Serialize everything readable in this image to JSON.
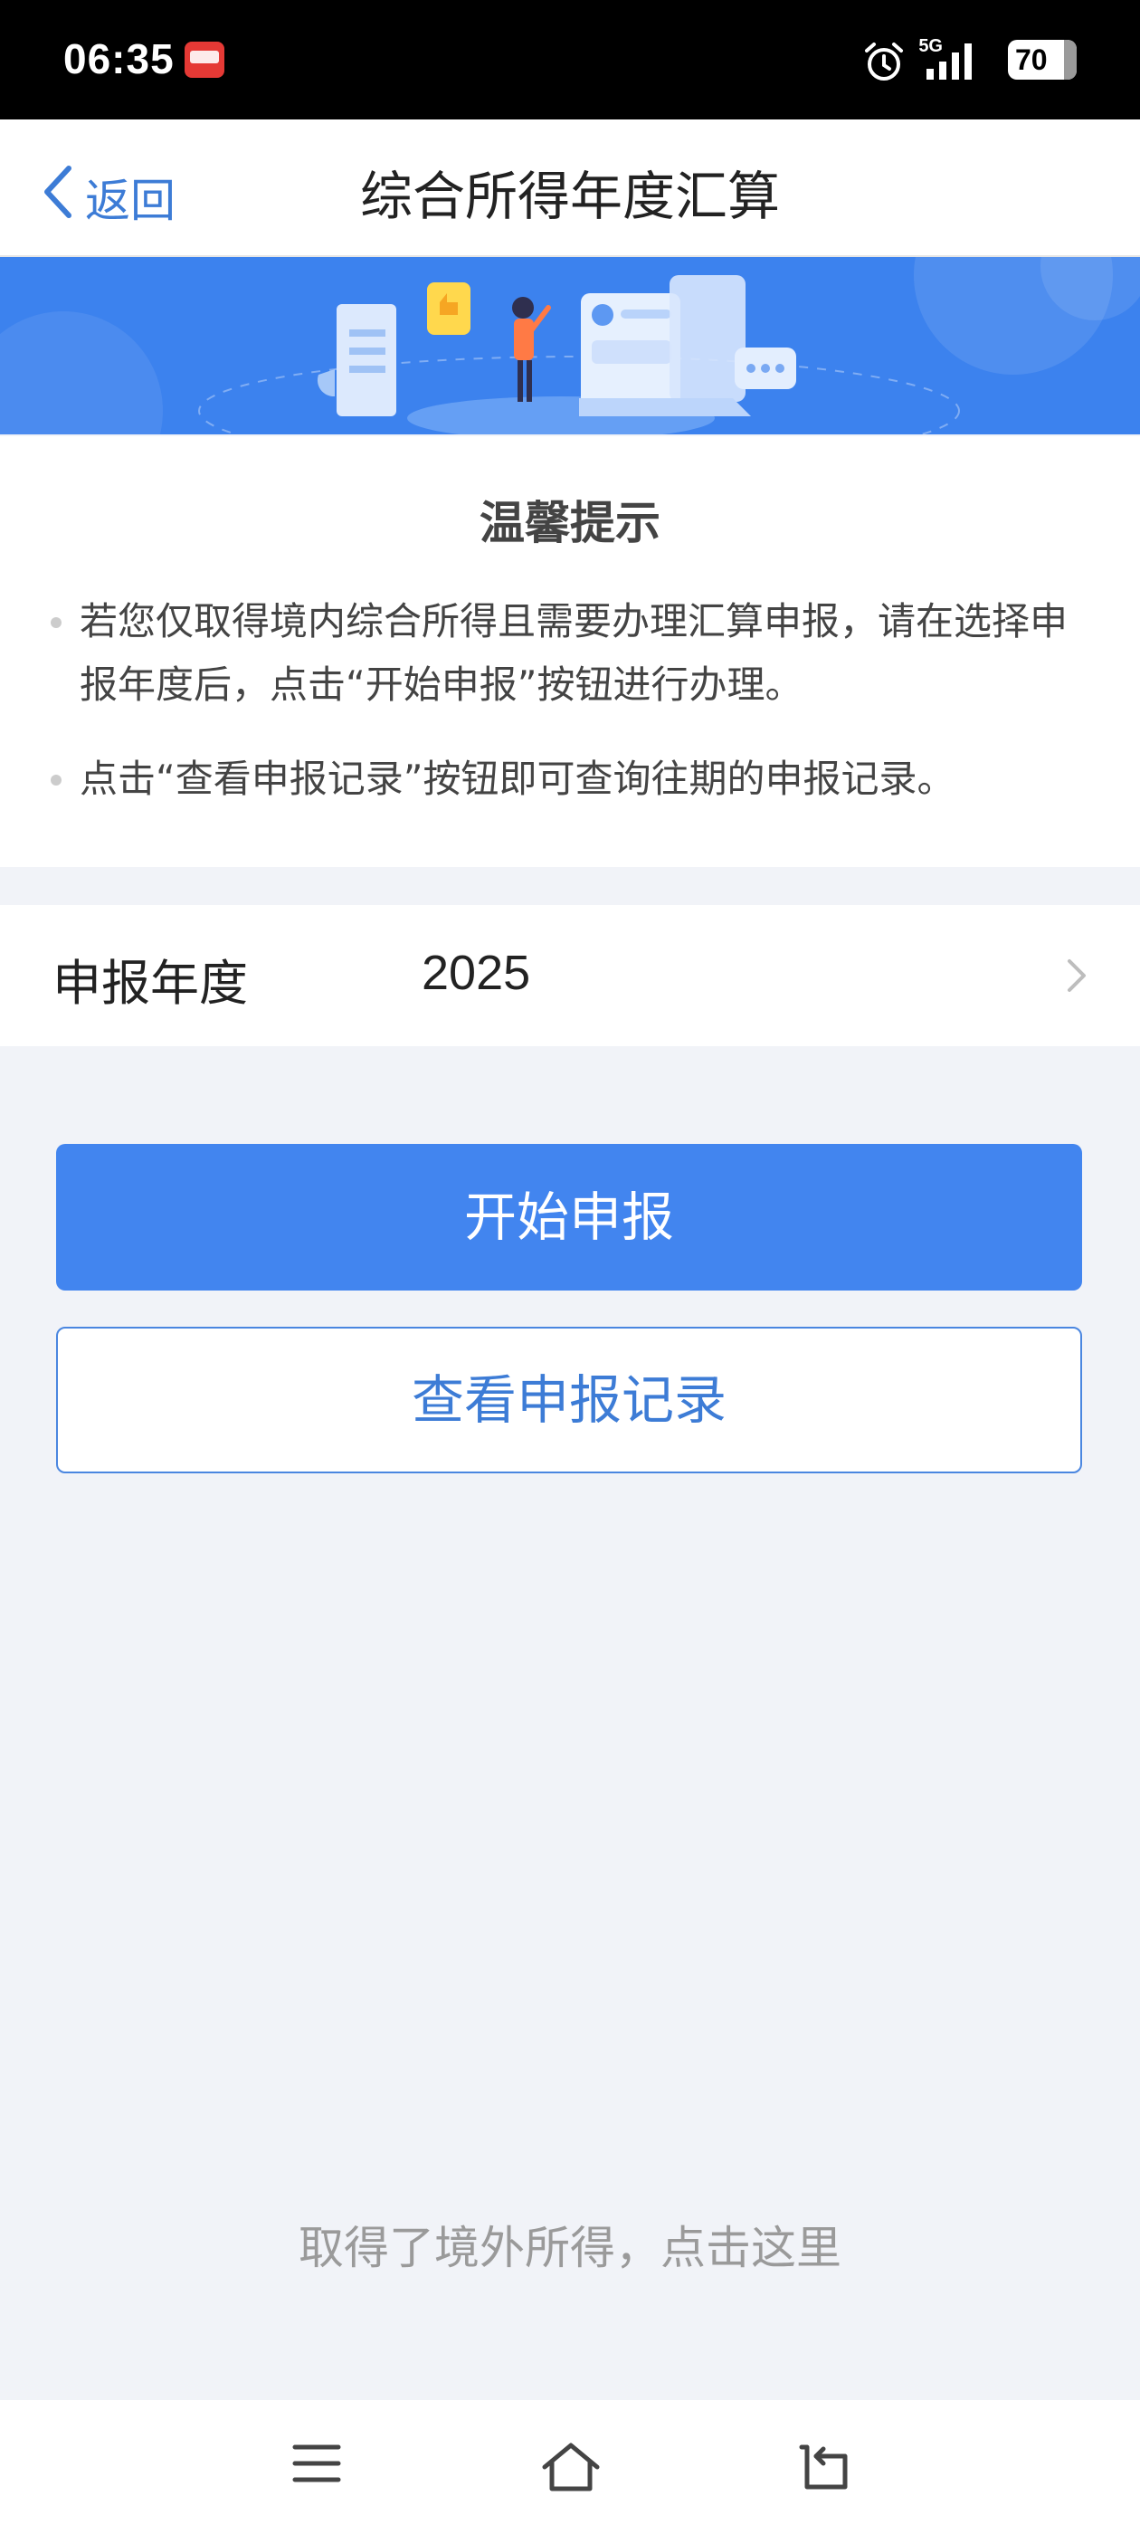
{
  "status_bar": {
    "time": "06:35",
    "network": "5G",
    "battery": "70",
    "icons": [
      "app-notification-icon",
      "alarm-icon",
      "signal-icon",
      "battery-icon"
    ]
  },
  "nav": {
    "back_label": "返回",
    "title": "综合所得年度汇算"
  },
  "tips": {
    "title": "温馨提示",
    "items": [
      "若您仅取得境内综合所得且需要办理汇算申报，请在选择申报年度后，点击“开始申报”按钮进行办理。",
      "点击“查看申报记录”按钮即可查询往期的申报记录。"
    ]
  },
  "year_row": {
    "label": "申报年度",
    "value": "2025"
  },
  "actions": {
    "start_label": "开始申报",
    "records_label": "查看申报记录"
  },
  "footer_link": "取得了境外所得，点击这里",
  "system_nav": {
    "icons": [
      "menu-icon",
      "home-icon",
      "back-icon"
    ]
  },
  "colors": {
    "primary": "#4285ef",
    "link": "#3d7cd6",
    "banner": "#3c82ee",
    "page_bg": "#f1f3f8"
  }
}
